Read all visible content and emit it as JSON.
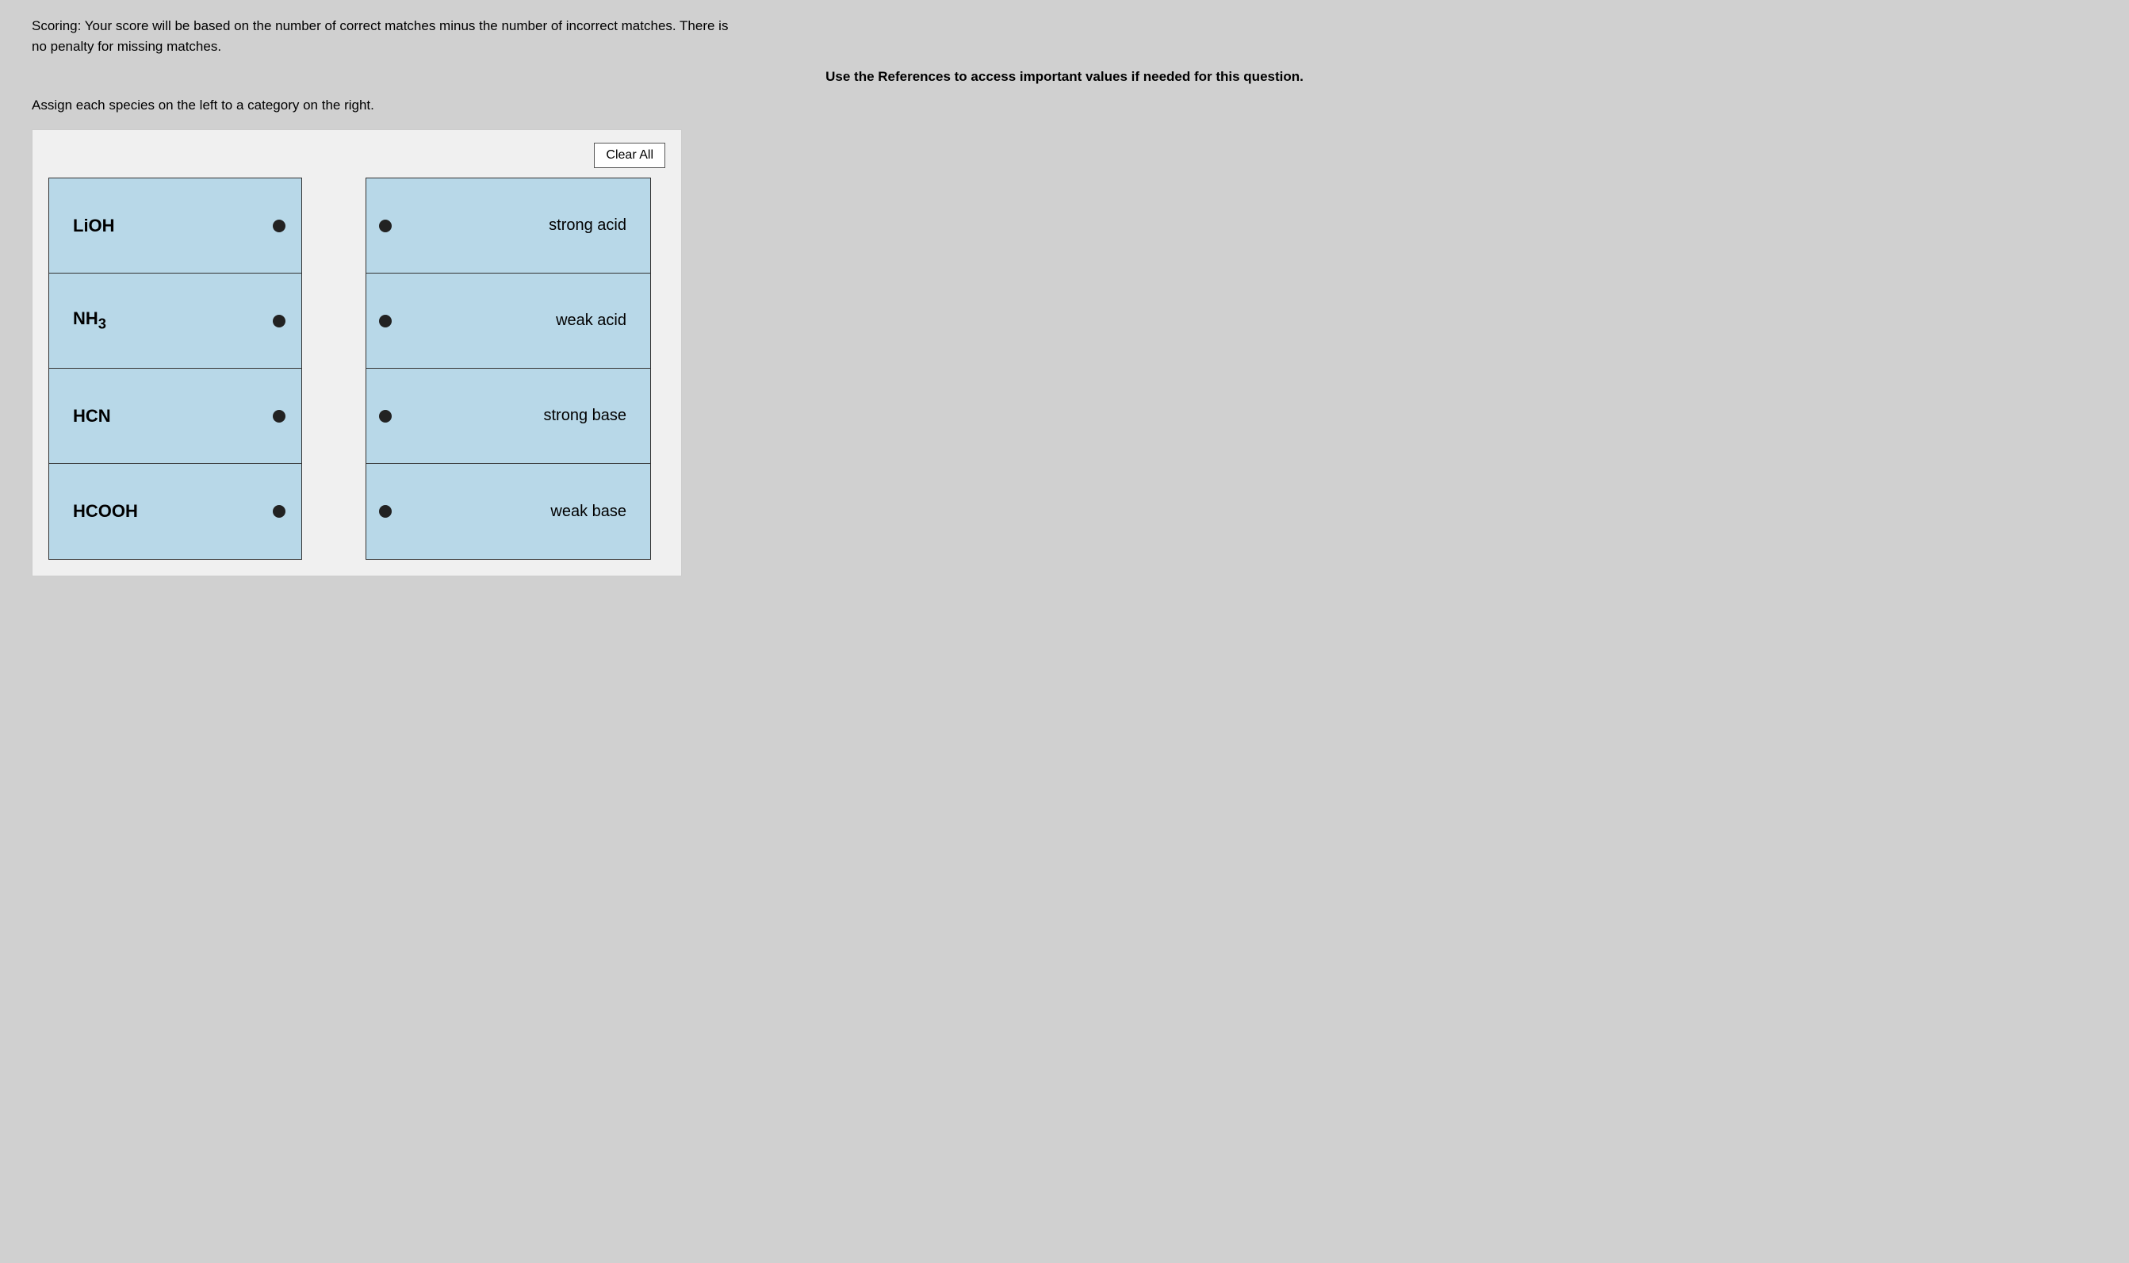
{
  "scoring": {
    "text1": "Scoring: Your score will be based on the number of correct matches minus the number of incorrect matches. There is no penalty for missing matches."
  },
  "references": {
    "text": "Use the References to access important values if needed for this question."
  },
  "instructions": {
    "text": "Assign each species on the left to a category on the right."
  },
  "clear_all": {
    "label": "Clear All"
  },
  "left_items": [
    {
      "id": "lioh",
      "label": "LiOH",
      "html": "LiOH"
    },
    {
      "id": "nh3",
      "label": "NH3",
      "html": "NH₃"
    },
    {
      "id": "hcn",
      "label": "HCN",
      "html": "HCN"
    },
    {
      "id": "hcooh",
      "label": "HCOOH",
      "html": "HCOOH"
    }
  ],
  "right_items": [
    {
      "id": "strong-acid",
      "label": "strong acid"
    },
    {
      "id": "weak-acid",
      "label": "weak acid"
    },
    {
      "id": "strong-base",
      "label": "strong base"
    },
    {
      "id": "weak-base",
      "label": "weak base"
    }
  ]
}
